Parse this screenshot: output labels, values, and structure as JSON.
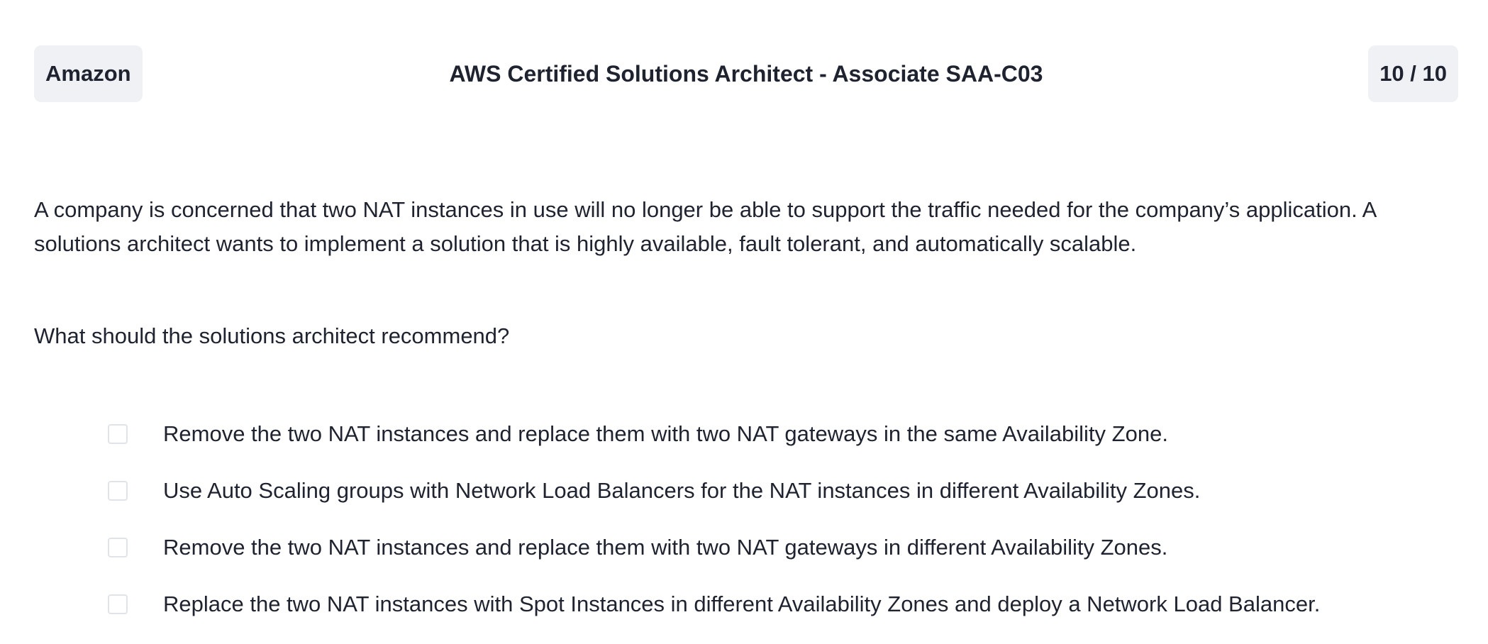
{
  "header": {
    "vendor": "Amazon",
    "exam_title": "AWS Certified Solutions Architect - Associate SAA-C03",
    "progress": "10 / 10"
  },
  "question": {
    "text": "A company is concerned that two NAT instances in use will no longer be able to support the traffic needed for the company’s application. A solutions architect wants to implement a solution that is highly available, fault tolerant, and automatically scalable.",
    "prompt": "What should the solutions architect recommend?"
  },
  "options": [
    {
      "label": "Remove the two NAT instances and replace them with two NAT gateways in the same Availability Zone.",
      "checked": false
    },
    {
      "label": "Use Auto Scaling groups with Network Load Balancers for the NAT instances in different Availability Zones.",
      "checked": false
    },
    {
      "label": "Remove the two NAT instances and replace them with two NAT gateways in different Availability Zones.",
      "checked": false
    },
    {
      "label": "Replace the two NAT instances with Spot Instances in different Availability Zones and deploy a Network Load Balancer.",
      "checked": false
    }
  ],
  "colors": {
    "text": "#1f2330",
    "pill_background": "#eff1f5",
    "checkbox_border": "#e0e3e8",
    "page_background": "#ffffff"
  }
}
